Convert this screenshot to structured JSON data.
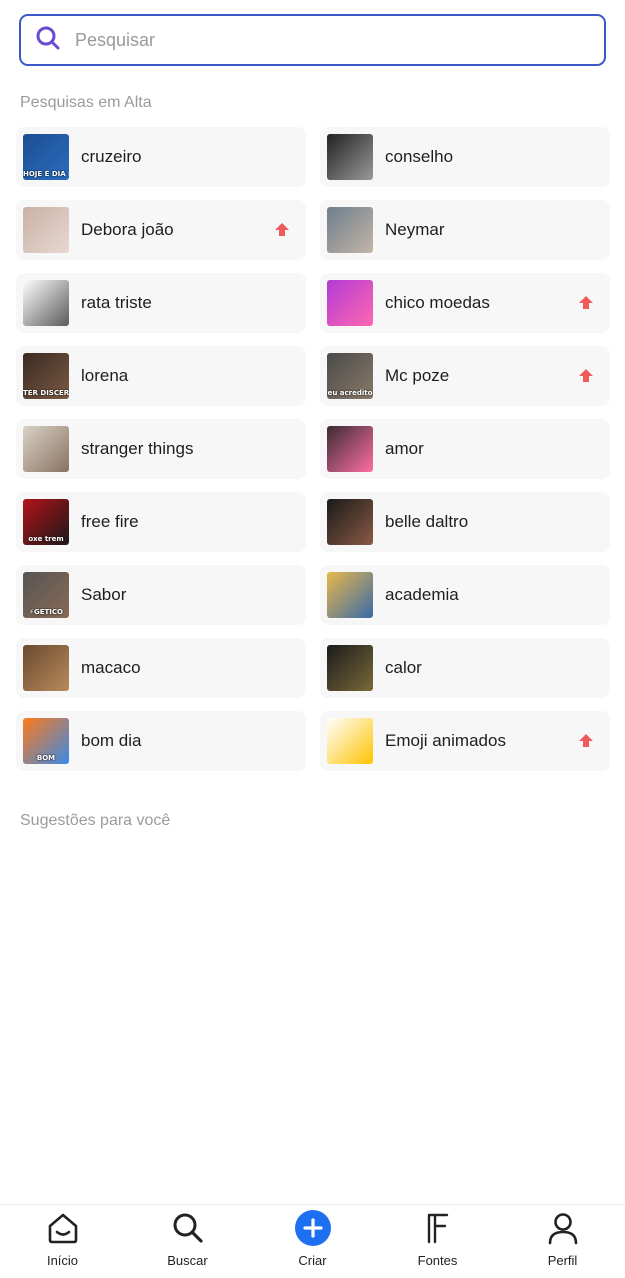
{
  "search": {
    "placeholder": "Pesquisar",
    "value": ""
  },
  "trending": {
    "title": "Pesquisas em Alta",
    "items": [
      {
        "label": "cruzeiro",
        "trending": false,
        "thumb_colors": [
          "#1d4d8f",
          "#2a6cc0"
        ],
        "thumb_text": "HOJE É DIA DE"
      },
      {
        "label": "conselho",
        "trending": false,
        "thumb_colors": [
          "#222222",
          "#9a9a9a"
        ],
        "thumb_text": ""
      },
      {
        "label": "Debora joão",
        "trending": true,
        "thumb_colors": [
          "#c9b1a6",
          "#e8d8d0"
        ],
        "thumb_text": ""
      },
      {
        "label": "Neymar",
        "trending": false,
        "thumb_colors": [
          "#6f7f8e",
          "#c4b5a8"
        ],
        "thumb_text": ""
      },
      {
        "label": "rata triste",
        "trending": false,
        "thumb_colors": [
          "#ffffff",
          "#5a5a5a"
        ],
        "thumb_text": ""
      },
      {
        "label": "chico moedas",
        "trending": true,
        "thumb_colors": [
          "#b23bd6",
          "#ff67b0"
        ],
        "thumb_text": ""
      },
      {
        "label": "lorena",
        "trending": false,
        "thumb_colors": [
          "#3b2a22",
          "#7a5a44"
        ],
        "thumb_text": "TER DISCER"
      },
      {
        "label": "Mc poze",
        "trending": true,
        "thumb_colors": [
          "#4a4a4a",
          "#8a7a6a"
        ],
        "thumb_text": "eu acredito"
      },
      {
        "label": "stranger things",
        "trending": false,
        "thumb_colors": [
          "#d9d2c7",
          "#8a7260"
        ],
        "thumb_text": ""
      },
      {
        "label": "amor",
        "trending": false,
        "thumb_colors": [
          "#3a2b33",
          "#ff6fa3"
        ],
        "thumb_text": ""
      },
      {
        "label": "free fire",
        "trending": false,
        "thumb_colors": [
          "#b3121a",
          "#1a1a1a"
        ],
        "thumb_text": "oxe trem"
      },
      {
        "label": "belle daltro",
        "trending": false,
        "thumb_colors": [
          "#1a1a1a",
          "#8a5a44"
        ],
        "thumb_text": ""
      },
      {
        "label": "Sabor",
        "trending": false,
        "thumb_colors": [
          "#555555",
          "#8a6a55"
        ],
        "thumb_text": "⚡GETICO"
      },
      {
        "label": "academia",
        "trending": false,
        "thumb_colors": [
          "#e8b84a",
          "#3a6aa8"
        ],
        "thumb_text": ""
      },
      {
        "label": "macaco",
        "trending": false,
        "thumb_colors": [
          "#6a4a30",
          "#b88a5a"
        ],
        "thumb_text": ""
      },
      {
        "label": "calor",
        "trending": false,
        "thumb_colors": [
          "#1a1a1a",
          "#7a6a3a"
        ],
        "thumb_text": ""
      },
      {
        "label": "bom dia",
        "trending": false,
        "thumb_colors": [
          "#ff7a1a",
          "#3a8ae8"
        ],
        "thumb_text": "BOM"
      },
      {
        "label": "Emoji animados",
        "trending": true,
        "thumb_colors": [
          "#ffffff",
          "#ffc400"
        ],
        "thumb_text": ""
      }
    ]
  },
  "suggestions": {
    "title": "Sugestões para você"
  },
  "bottom_nav": {
    "items": [
      {
        "label": "Início",
        "icon": "home-icon"
      },
      {
        "label": "Buscar",
        "icon": "search-icon"
      },
      {
        "label": "Criar",
        "icon": "plus-circle-icon"
      },
      {
        "label": "Fontes",
        "icon": "font-icon"
      },
      {
        "label": "Perfil",
        "icon": "user-icon"
      }
    ]
  },
  "colors": {
    "accent": "#3b57c8",
    "search_icon": "#6b4bd1",
    "trend_arrow": "#ef5a5a",
    "create_button": "#1f6ff2",
    "item_bg": "#f7f7f7",
    "section_title": "#9b9b9b"
  }
}
